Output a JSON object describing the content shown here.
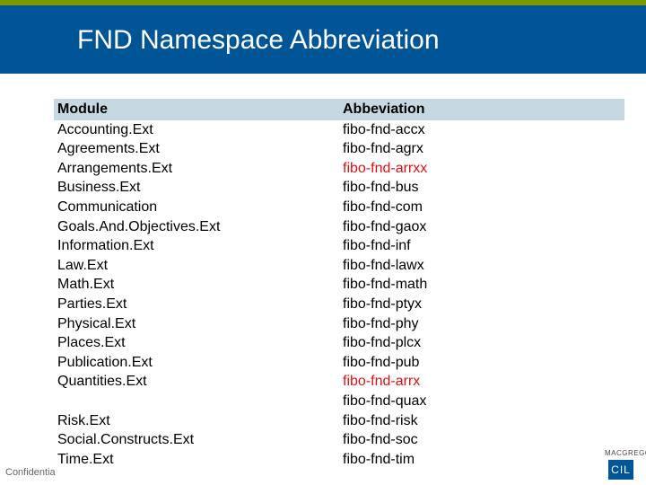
{
  "title": "FND Namespace Abbreviation",
  "columns": {
    "module": "Module",
    "abbr": "Abbeviation"
  },
  "rows": [
    {
      "module": "Accounting.Ext",
      "abbr": "fibo-fnd-accx",
      "red": false
    },
    {
      "module": "Agreements.Ext",
      "abbr": "fibo-fnd-agrx",
      "red": false
    },
    {
      "module": "Arrangements.Ext",
      "abbr": "fibo-fnd-arrxx",
      "red": true
    },
    {
      "module": "Business.Ext",
      "abbr": "fibo-fnd-bus",
      "red": false
    },
    {
      "module": "Communication",
      "abbr": "fibo-fnd-com",
      "red": false
    },
    {
      "module": "Goals.And.Objectives.Ext",
      "abbr": "fibo-fnd-gaox",
      "red": false
    },
    {
      "module": "Information.Ext",
      "abbr": "fibo-fnd-inf",
      "red": false
    },
    {
      "module": "Law.Ext",
      "abbr": "fibo-fnd-lawx",
      "red": false
    },
    {
      "module": "Math.Ext",
      "abbr": "fibo-fnd-math",
      "red": false
    },
    {
      "module": "Parties.Ext",
      "abbr": "fibo-fnd-ptyx",
      "red": false
    },
    {
      "module": "Physical.Ext",
      "abbr": "fibo-fnd-phy",
      "red": false
    },
    {
      "module": "Places.Ext",
      "abbr": "fibo-fnd-plcx",
      "red": false
    },
    {
      "module": "Publication.Ext",
      "abbr": "fibo-fnd-pub",
      "red": false
    },
    {
      "module": "Quantities.Ext",
      "abbr": "fibo-fnd-arrx",
      "red": true
    },
    {
      "module": "",
      "abbr": "fibo-fnd-quax",
      "red": false
    },
    {
      "module": "Risk.Ext",
      "abbr": "fibo-fnd-risk",
      "red": false
    },
    {
      "module": "Social.Constructs.Ext",
      "abbr": "fibo-fnd-soc",
      "red": false
    },
    {
      "module": "Time.Ext",
      "abbr": "fibo-fnd-tim",
      "red": false
    }
  ],
  "footer": {
    "confidential": "Confidentia"
  },
  "logo": {
    "top": "MACGREGOR",
    "box": "CIL"
  },
  "chart_data": {
    "type": "table",
    "title": "FND Namespace Abbreviation",
    "columns": [
      "Module",
      "Abbeviation"
    ],
    "rows": [
      [
        "Accounting.Ext",
        "fibo-fnd-accx"
      ],
      [
        "Agreements.Ext",
        "fibo-fnd-agrx"
      ],
      [
        "Arrangements.Ext",
        "fibo-fnd-arrxx"
      ],
      [
        "Business.Ext",
        "fibo-fnd-bus"
      ],
      [
        "Communication",
        "fibo-fnd-com"
      ],
      [
        "Goals.And.Objectives.Ext",
        "fibo-fnd-gaox"
      ],
      [
        "Information.Ext",
        "fibo-fnd-inf"
      ],
      [
        "Law.Ext",
        "fibo-fnd-lawx"
      ],
      [
        "Math.Ext",
        "fibo-fnd-math"
      ],
      [
        "Parties.Ext",
        "fibo-fnd-ptyx"
      ],
      [
        "Physical.Ext",
        "fibo-fnd-phy"
      ],
      [
        "Places.Ext",
        "fibo-fnd-plcx"
      ],
      [
        "Publication.Ext",
        "fibo-fnd-pub"
      ],
      [
        "Quantities.Ext",
        "fibo-fnd-arrx"
      ],
      [
        "",
        "fibo-fnd-quax"
      ],
      [
        "Risk.Ext",
        "fibo-fnd-risk"
      ],
      [
        "Social.Constructs.Ext",
        "fibo-fnd-soc"
      ],
      [
        "Time.Ext",
        "fibo-fnd-tim"
      ]
    ]
  }
}
